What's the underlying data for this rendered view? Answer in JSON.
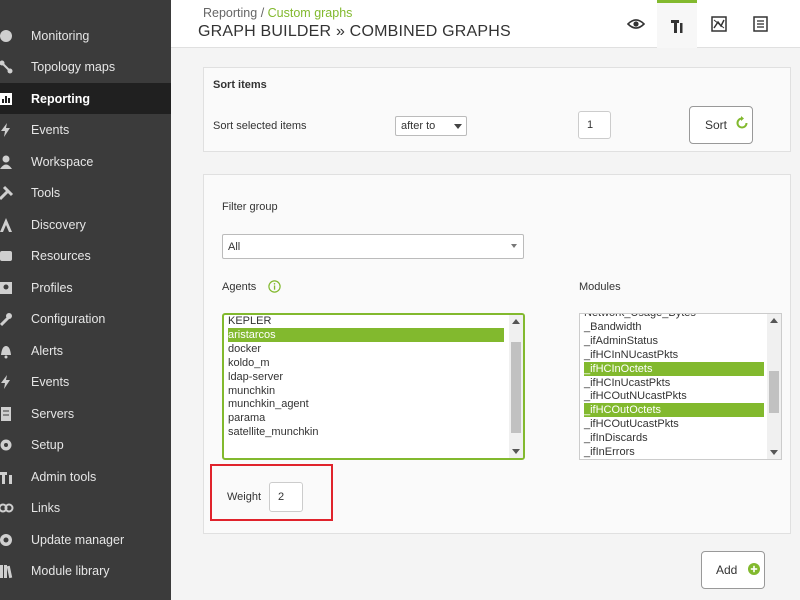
{
  "sidebar": {
    "items": [
      {
        "label": "Monitoring",
        "icon": "monitor-icon"
      },
      {
        "label": "Topology maps",
        "icon": "topology-icon"
      },
      {
        "label": "Reporting",
        "icon": "chart-icon",
        "active": true
      },
      {
        "label": "Events",
        "icon": "lightning-icon"
      },
      {
        "label": "Workspace",
        "icon": "user-icon"
      },
      {
        "label": "Tools",
        "icon": "tools-icon"
      },
      {
        "label": "Discovery",
        "icon": "discovery-icon"
      },
      {
        "label": "Resources",
        "icon": "resources-icon"
      },
      {
        "label": "Profiles",
        "icon": "profile-icon"
      },
      {
        "label": "Configuration",
        "icon": "wrench-icon"
      },
      {
        "label": "Alerts",
        "icon": "bell-icon"
      },
      {
        "label": "Events",
        "icon": "lightning-icon"
      },
      {
        "label": "Servers",
        "icon": "server-icon"
      },
      {
        "label": "Setup",
        "icon": "gear-icon"
      },
      {
        "label": "Admin tools",
        "icon": "admin-tools-icon"
      },
      {
        "label": "Links",
        "icon": "link-icon"
      },
      {
        "label": "Update manager",
        "icon": "update-icon"
      },
      {
        "label": "Module library",
        "icon": "library-icon"
      }
    ]
  },
  "header": {
    "breadcrumb_parent": "Reporting",
    "breadcrumb_sep": "/",
    "breadcrumb_current": "Custom graphs",
    "title": "GRAPH BUILDER » COMBINED GRAPHS",
    "buttons": [
      "eye-icon",
      "builder-icon",
      "graph-icon",
      "list-icon"
    ]
  },
  "sort": {
    "section_title": "Sort items",
    "label": "Sort selected items",
    "position_value": "after to",
    "index_value": "1",
    "button_label": "Sort"
  },
  "filter": {
    "group_label": "Filter group",
    "group_value": "All",
    "agents_label": "Agents",
    "modules_label": "Modules",
    "agents": [
      {
        "name": "KEPLER",
        "selected": false
      },
      {
        "name": "aristarcos",
        "selected": true
      },
      {
        "name": "docker",
        "selected": false
      },
      {
        "name": "koldo_m",
        "selected": false
      },
      {
        "name": "ldap-server",
        "selected": false
      },
      {
        "name": "munchkin",
        "selected": false
      },
      {
        "name": "munchkin_agent",
        "selected": false
      },
      {
        "name": "parama",
        "selected": false
      },
      {
        "name": "satellite_munchkin",
        "selected": false
      }
    ],
    "modules": [
      {
        "name": "Network_Usage_Bytes",
        "selected": false
      },
      {
        "name": "_Bandwidth",
        "selected": false
      },
      {
        "name": "_ifAdminStatus",
        "selected": false
      },
      {
        "name": "_ifHCInNUcastPkts",
        "selected": false
      },
      {
        "name": "_ifHCInOctets",
        "selected": true
      },
      {
        "name": "_ifHCInUcastPkts",
        "selected": false
      },
      {
        "name": "_ifHCOutNUcastPkts",
        "selected": false
      },
      {
        "name": "_ifHCOutOctets",
        "selected": true
      },
      {
        "name": "_ifHCOutUcastPkts",
        "selected": false
      },
      {
        "name": "_ifInDiscards",
        "selected": false
      },
      {
        "name": "_ifInErrors",
        "selected": false
      }
    ],
    "weight_label": "Weight",
    "weight_value": "2"
  },
  "add_button_label": "Add",
  "colors": {
    "accent": "#82b92e",
    "sidebar_bg": "#3b3b3b",
    "sidebar_active": "#202020",
    "highlight_box": "#e0232c"
  }
}
